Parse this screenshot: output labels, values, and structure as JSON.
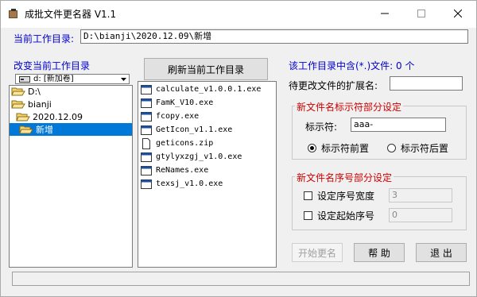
{
  "window": {
    "title": "成批文件更名器 V1.1"
  },
  "current_dir": {
    "label": "当前工作目录:",
    "value": "D:\\bianji\\2020.12.09\\新增"
  },
  "change_dir": {
    "label": "改变当前工作目录",
    "drive": "d: [新加卷]",
    "tree": [
      {
        "label": "D:\\"
      },
      {
        "label": "bianji"
      },
      {
        "label": "2020.12.09"
      },
      {
        "label": "新增",
        "selected": true
      }
    ]
  },
  "files": {
    "refresh_label": "刷新当前工作目录",
    "items": [
      "calculate_v1.0.0.1.exe",
      "FamK_V10.exe",
      "fcopy.exe",
      "GetIcon_v1.1.exe",
      "geticons.zip",
      "gtylyxzgj_v1.0.exe",
      "ReNames.exe",
      "texsj_v1.0.exe"
    ]
  },
  "right": {
    "ext_info": "该工作目录中含(*.)文件: 0 个",
    "ext_label": "待更改文件的扩展名:",
    "ext_value": "",
    "name_group": {
      "title": "新文件名标示符部分设定",
      "marker_label": "标示符:",
      "marker_value": "aaa-",
      "option_front": "标示符前置",
      "option_back": "标示符后置"
    },
    "seq_group": {
      "title": "新文件名序号部分设定",
      "width_label": "设定序号宽度",
      "width_value": "3",
      "start_label": "设定起始序号",
      "start_value": "0"
    }
  },
  "buttons": {
    "start": "开始更名",
    "help": "帮  助",
    "exit": "退  出"
  },
  "colors": {
    "accent_blue": "#0000cc",
    "group_title_red": "#cc0000",
    "selection": "#0078d7"
  }
}
